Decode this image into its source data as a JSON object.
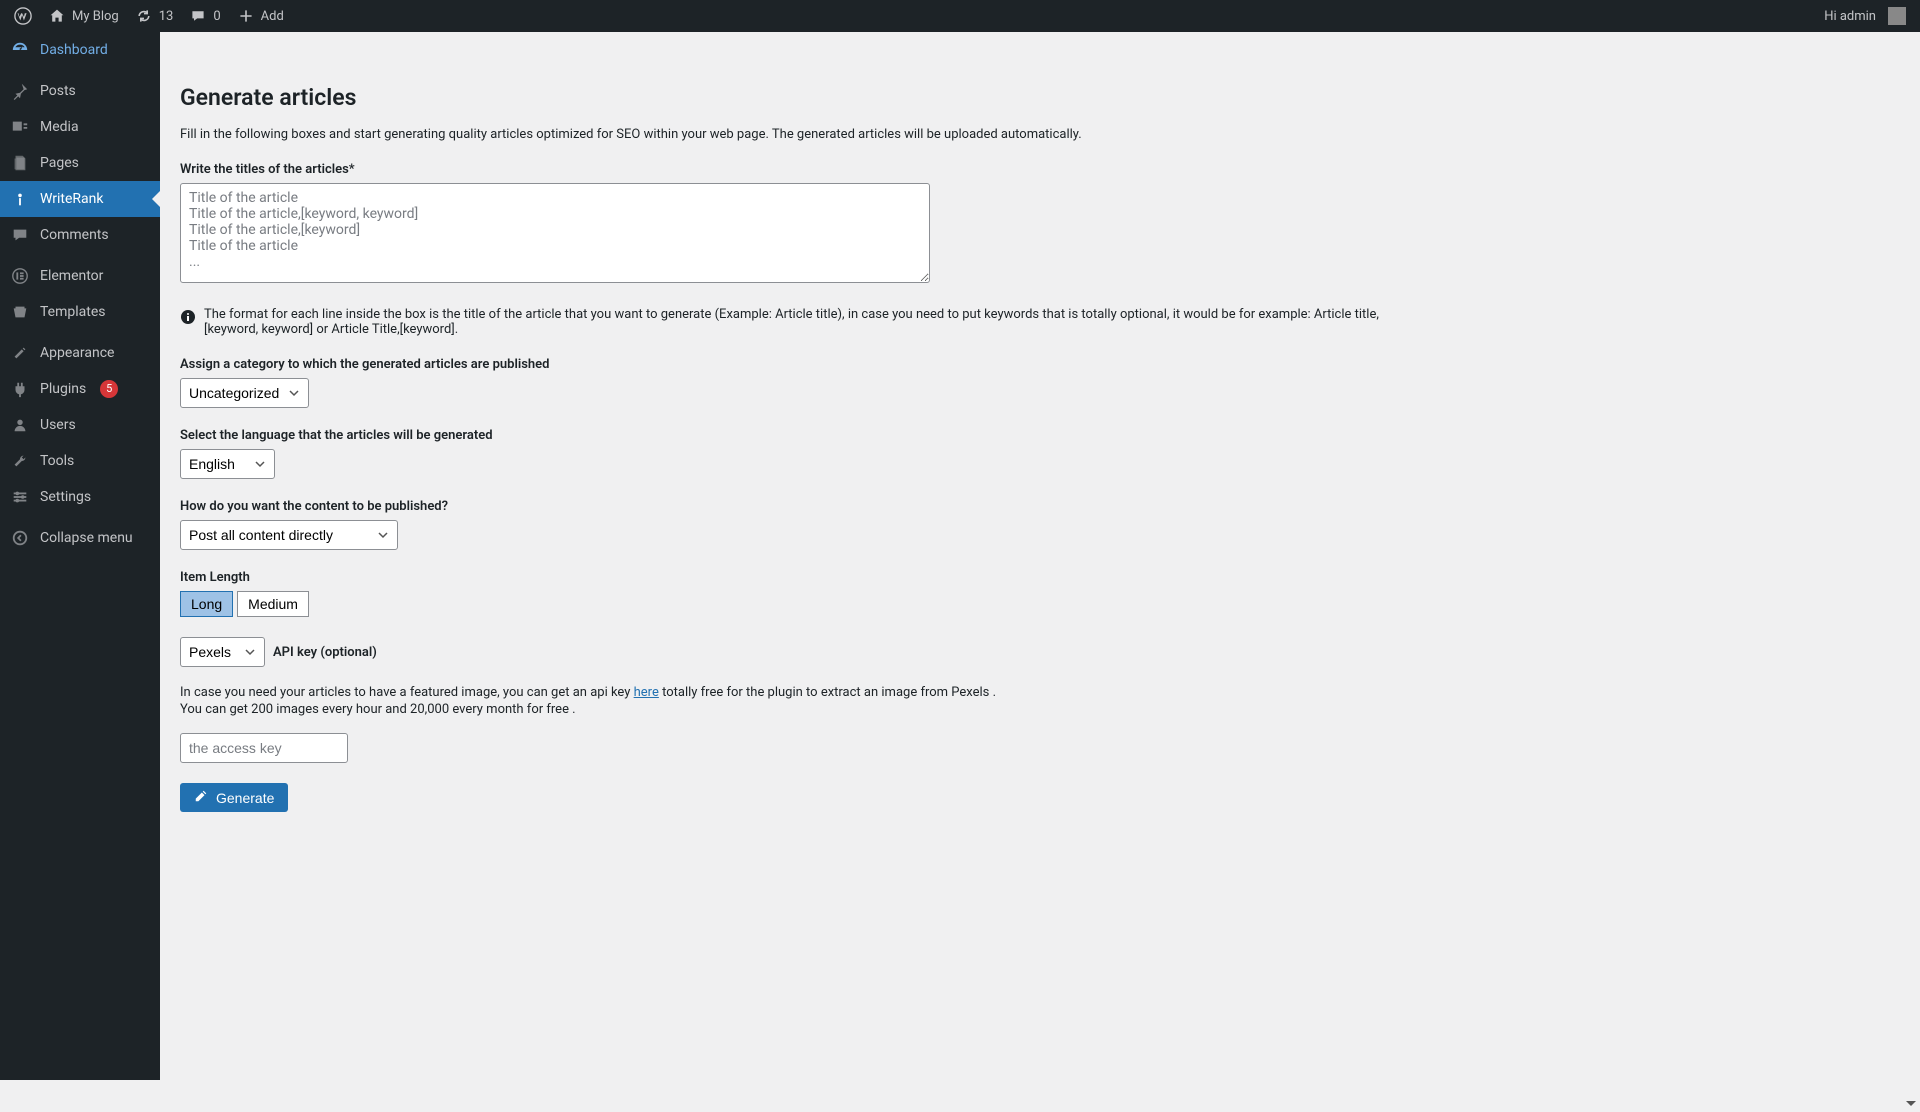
{
  "toolbar": {
    "site_title": "My Blog",
    "updates_count": "13",
    "comments_count": "0",
    "add_label": "Add",
    "greeting": "Hi admin"
  },
  "sidebar": {
    "items": [
      {
        "label": "Dashboard",
        "icon": "dashboard"
      },
      {
        "label": "Posts",
        "icon": "pin"
      },
      {
        "label": "Media",
        "icon": "media"
      },
      {
        "label": "Pages",
        "icon": "pages"
      },
      {
        "label": "WriteRank",
        "icon": "writerank"
      },
      {
        "label": "Comments",
        "icon": "comment"
      },
      {
        "label": "Elementor",
        "icon": "elementor"
      },
      {
        "label": "Templates",
        "icon": "templates"
      },
      {
        "label": "Appearance",
        "icon": "appearance"
      },
      {
        "label": "Plugins",
        "icon": "plugins",
        "badge": "5"
      },
      {
        "label": "Users",
        "icon": "users"
      },
      {
        "label": "Tools",
        "icon": "tools"
      },
      {
        "label": "Settings",
        "icon": "settings"
      },
      {
        "label": "Collapse menu",
        "icon": "collapse"
      }
    ]
  },
  "page": {
    "title": "Generate articles",
    "description": "Fill in the following boxes and start generating quality articles optimized for SEO within your web page. The generated articles will be uploaded automatically.",
    "titles_label": "Write the titles of the articles*",
    "titles_placeholder": "Title of the article\nTitle of the article,[keyword, keyword]\nTitle of the article,[keyword]\nTitle of the article\n...",
    "format_info": "The format for each line inside the box is the title of the article that you want to generate (Example: Article title), in case you need to put keywords that is totally optional, it would be for example: Article title,[keyword, keyword] or Article Title,[keyword].",
    "category_label": "Assign a category to which the generated articles are published",
    "category_value": "Uncategorized",
    "language_label": "Select the language that the articles will be generated",
    "language_value": "English",
    "publish_label": "How do you want the content to be published?",
    "publish_value": "Post all content directly",
    "length_label": "Item Length",
    "length_long": "Long",
    "length_medium": "Medium",
    "image_source_value": "Pexels",
    "api_key_label": "API key (optional)",
    "help_text_1a": "In case you need your articles to have a featured image, you can get an api key ",
    "help_link": "here",
    "help_text_1b": " totally free for the plugin to extract an image from Pexels .",
    "help_text_2": "You can get 200 images every hour and 20,000 every month for free .",
    "key_placeholder": "the access key",
    "generate_label": "Generate"
  }
}
